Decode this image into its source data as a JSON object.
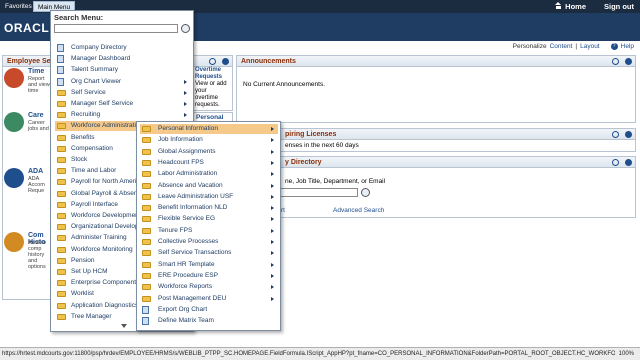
{
  "topbar": {
    "favorites": "Favorites",
    "main_menu": "Main Menu",
    "home": "Home",
    "sign_out": "Sign out"
  },
  "header": {
    "logo": "ORACL"
  },
  "personalize": {
    "prefix": "Personalize",
    "content": "Content",
    "sep": "|",
    "layout": "Layout",
    "help": "Help"
  },
  "ess": {
    "title": "Employee Self",
    "items": [
      {
        "title": "Time",
        "desc": "Report and view time"
      },
      {
        "title": "Care",
        "desc": "Career jobs and"
      },
      {
        "title": "ADA",
        "desc": "ADA Accom Reque"
      },
      {
        "title": "Com Histo",
        "desc": "Review comp history and options"
      }
    ]
  },
  "overtime": {
    "title": "Overtime Requests",
    "desc": "View or add your overtime requests."
  },
  "personal": {
    "title": "Personal"
  },
  "announcements": {
    "title": "Announcements",
    "body": "No Current Announcements."
  },
  "expiring": {
    "title": "piring Licenses",
    "body": "enses in the next 60 days"
  },
  "directory": {
    "title": "y Directory",
    "hint": "ne, Job Title, Department, or Email",
    "link1": "rt",
    "advanced": "Advanced Search"
  },
  "menu": {
    "title": "Search Menu:",
    "items": [
      {
        "label": "Company Directory",
        "type": "doc",
        "arrow": false
      },
      {
        "label": "Manager Dashboard",
        "type": "doc",
        "arrow": false
      },
      {
        "label": "Talent Summary",
        "type": "doc",
        "arrow": false
      },
      {
        "label": "Org Chart Viewer",
        "type": "doc",
        "arrow": true
      },
      {
        "label": "Self Service",
        "type": "fold",
        "arrow": true
      },
      {
        "label": "Manager Self Service",
        "type": "fold",
        "arrow": true
      },
      {
        "label": "Recruiting",
        "type": "fold",
        "arrow": true
      },
      {
        "label": "Workforce Administration",
        "type": "fold",
        "arrow": true
      },
      {
        "label": "Benefits",
        "type": "fold",
        "arrow": false
      },
      {
        "label": "Compensation",
        "type": "fold",
        "arrow": false
      },
      {
        "label": "Stock",
        "type": "fold",
        "arrow": false
      },
      {
        "label": "Time and Labor",
        "type": "fold",
        "arrow": false
      },
      {
        "label": "Payroll for North America",
        "type": "fold",
        "arrow": false
      },
      {
        "label": "Global Payroll & Absence",
        "type": "fold",
        "arrow": false
      },
      {
        "label": "Payroll Interface",
        "type": "fold",
        "arrow": false
      },
      {
        "label": "Workforce Development",
        "type": "fold",
        "arrow": false
      },
      {
        "label": "Organizational Development",
        "type": "fold",
        "arrow": false
      },
      {
        "label": "Administer Training",
        "type": "fold",
        "arrow": false
      },
      {
        "label": "Workforce Monitoring",
        "type": "fold",
        "arrow": false
      },
      {
        "label": "Pension",
        "type": "fold",
        "arrow": false
      },
      {
        "label": "Set Up HCM",
        "type": "fold",
        "arrow": false
      },
      {
        "label": "Enterprise Components",
        "type": "fold",
        "arrow": false
      },
      {
        "label": "Worklist",
        "type": "fold",
        "arrow": false
      },
      {
        "label": "Application Diagnostics",
        "type": "fold",
        "arrow": false
      },
      {
        "label": "Tree Manager",
        "type": "fold",
        "arrow": false
      }
    ]
  },
  "submenu": {
    "items": [
      {
        "label": "Personal Information",
        "type": "fold",
        "arrow": true
      },
      {
        "label": "Job Information",
        "type": "fold",
        "arrow": true
      },
      {
        "label": "Global Assignments",
        "type": "fold",
        "arrow": true
      },
      {
        "label": "Headcount FPS",
        "type": "fold",
        "arrow": true
      },
      {
        "label": "Labor Administration",
        "type": "fold",
        "arrow": true
      },
      {
        "label": "Absence and Vacation",
        "type": "fold",
        "arrow": true
      },
      {
        "label": "Leave Administration USF",
        "type": "fold",
        "arrow": true
      },
      {
        "label": "Benefit Information NLD",
        "type": "fold",
        "arrow": true
      },
      {
        "label": "Flexible Service EG",
        "type": "fold",
        "arrow": true
      },
      {
        "label": "Tenure FPS",
        "type": "fold",
        "arrow": true
      },
      {
        "label": "Collective Processes",
        "type": "fold",
        "arrow": true
      },
      {
        "label": "Self Service Transactions",
        "type": "fold",
        "arrow": true
      },
      {
        "label": "Smart HR Template",
        "type": "fold",
        "arrow": true
      },
      {
        "label": "ERE Procedure ESP",
        "type": "fold",
        "arrow": true
      },
      {
        "label": "Workforce Reports",
        "type": "fold",
        "arrow": true
      },
      {
        "label": "Post Management DEU",
        "type": "fold",
        "arrow": true
      },
      {
        "label": "Export Org Chart",
        "type": "doc",
        "arrow": false
      },
      {
        "label": "Define Matrix Team",
        "type": "doc",
        "arrow": false
      }
    ]
  },
  "status": {
    "url": "https://hrtest.mdcourts.gov:11800/psp/hrdev/EMPLOYEE/HRMS/s/WEBLIB_PTPP_SC.HOMEPAGE.FieldFormula.IScript_AppHP?pt_fname=CO_PERSONAL_INFORMATION&FolderPath=PORTAL_ROOT_OBJECT.HC_WORKFORCE",
    "zoom": "100%"
  }
}
